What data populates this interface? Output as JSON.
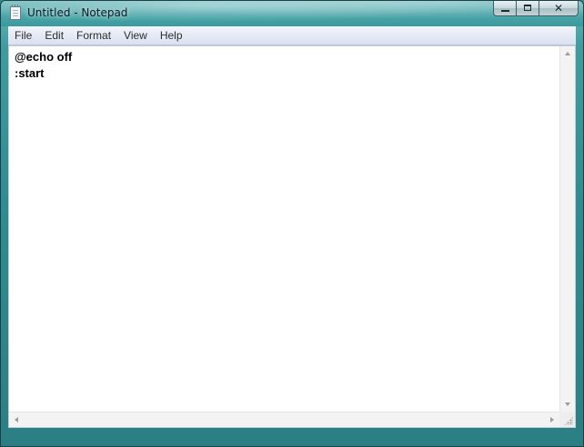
{
  "window": {
    "title": "Untitled - Notepad",
    "close_glyph": "✕"
  },
  "menu": {
    "items": [
      {
        "label": "File"
      },
      {
        "label": "Edit"
      },
      {
        "label": "Format"
      },
      {
        "label": "View"
      },
      {
        "label": "Help"
      }
    ]
  },
  "editor": {
    "content": "@echo off\n:start"
  },
  "icons": {
    "app": "notepad-icon",
    "minimize": "minimize-icon",
    "maximize": "maximize-icon",
    "close": "close-icon"
  },
  "colors": {
    "glass_frame": "#3f9da0",
    "editor_bg": "#ffffff",
    "menubar_bg": "#e6eaf6"
  }
}
